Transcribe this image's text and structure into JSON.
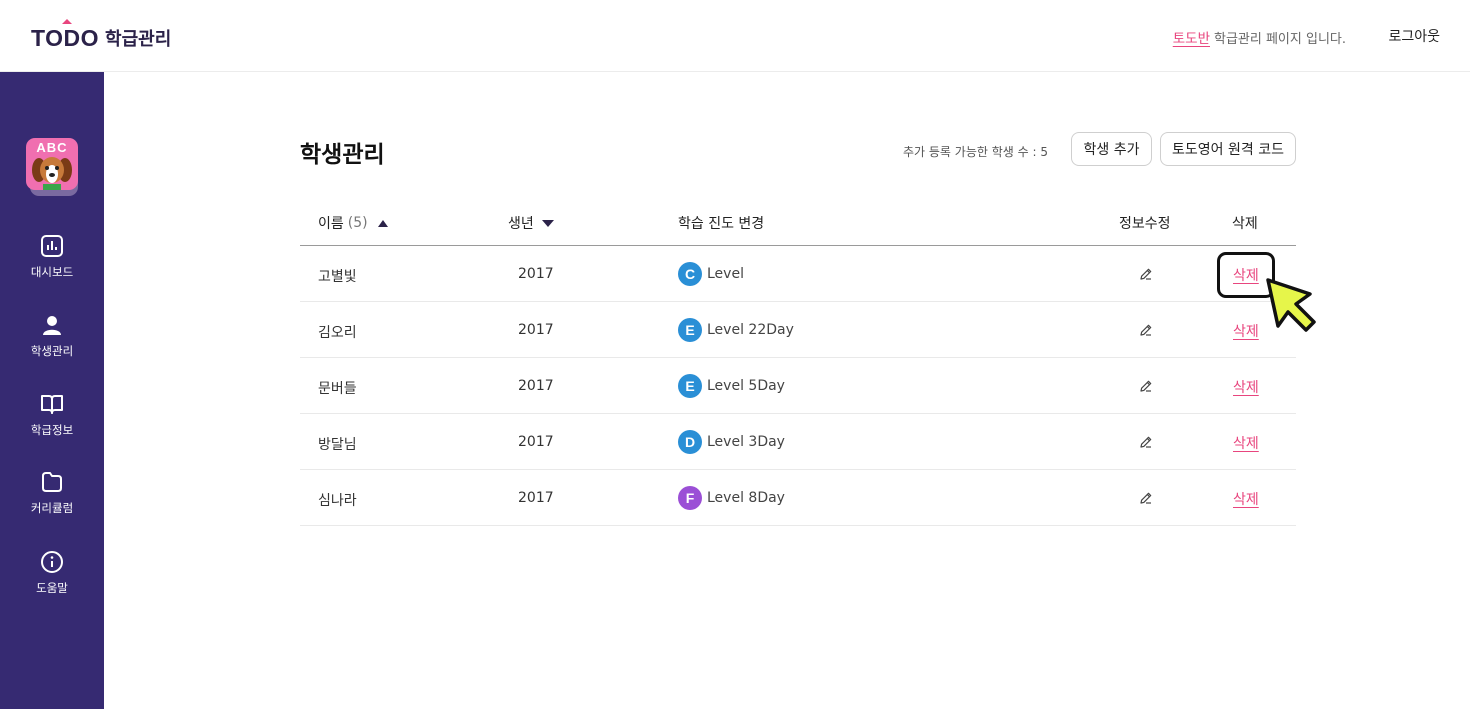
{
  "header": {
    "logo_text": "TODO",
    "logo_sub": "학급관리",
    "class_name": "토도반",
    "message": "학급관리 페이지 입니다.",
    "logout_label": "로그아웃"
  },
  "sidebar": {
    "avatar_text": "ABC",
    "items": [
      {
        "label": "대시보드",
        "icon": "chart-icon"
      },
      {
        "label": "학생관리",
        "icon": "user-icon"
      },
      {
        "label": "학급정보",
        "icon": "book-icon"
      },
      {
        "label": "커리큘럼",
        "icon": "folder-icon"
      },
      {
        "label": "도움말",
        "icon": "info-icon"
      }
    ]
  },
  "main": {
    "title": "학생관리",
    "remaining_text": "추가 등록 가능한 학생 수 : 5",
    "add_button": "학생 추가",
    "code_button": "토도영어 원격 코드"
  },
  "table": {
    "headers": {
      "name": "이름",
      "count": "(5)",
      "year": "생년",
      "progress": "학습 진도 변경",
      "edit": "정보수정",
      "delete": "삭제"
    },
    "rows": [
      {
        "name": "고별빛",
        "year": "2017",
        "badge": "C",
        "badge_color": "#2a8fd6",
        "level": "Level",
        "delete": "삭제"
      },
      {
        "name": "김오리",
        "year": "2017",
        "badge": "E",
        "badge_color": "#2a8fd6",
        "level": "Level 22Day",
        "delete": "삭제"
      },
      {
        "name": "문버들",
        "year": "2017",
        "badge": "E",
        "badge_color": "#2a8fd6",
        "level": "Level 5Day",
        "delete": "삭제"
      },
      {
        "name": "방달님",
        "year": "2017",
        "badge": "D",
        "badge_color": "#2a8fd6",
        "level": "Level 3Day",
        "delete": "삭제"
      },
      {
        "name": "심나라",
        "year": "2017",
        "badge": "F",
        "badge_color": "#9b4fd6",
        "level": "Level 8Day",
        "delete": "삭제"
      }
    ]
  },
  "colors": {
    "sidebar_bg": "#362a72",
    "accent": "#e8457e",
    "cursor_fill": "#e6f54a"
  }
}
